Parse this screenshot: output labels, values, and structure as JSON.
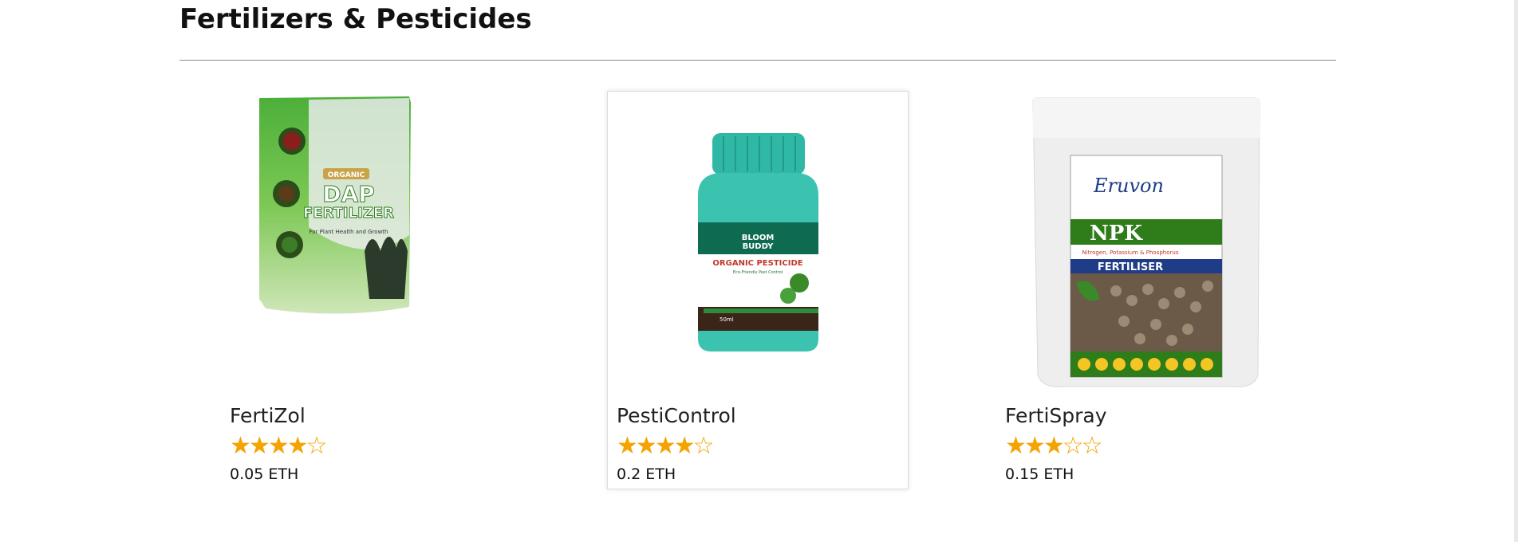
{
  "section": {
    "title": "Fertilizers & Pesticides"
  },
  "products": [
    {
      "name": "FertiZol",
      "rating": 4,
      "max_rating": 5,
      "price": "0.05 ETH",
      "image_text": {
        "top": "ORGANIC",
        "main1": "DAP",
        "main2": "FERTILIZER",
        "tagline": "For Plant Health and Growth"
      }
    },
    {
      "name": "PestiControl",
      "rating": 4,
      "max_rating": 5,
      "price": "0.2 ETH",
      "image_text": {
        "brand1": "BLOOM",
        "brand2": "BUDDY",
        "main": "ORGANIC PESTICIDE",
        "sub": "Eco-Friendly Pest Control",
        "volume": "50ml"
      }
    },
    {
      "name": "FertiSpray",
      "rating": 3,
      "max_rating": 5,
      "price": "0.15 ETH",
      "image_text": {
        "brand": "Eruvon",
        "main": "NPK",
        "sub": "Nitrogen, Potassium & Phosphorus",
        "band": "FERTILISER"
      }
    }
  ],
  "colors": {
    "star": "#f4a300",
    "divider": "#8a8a8a",
    "bottle": "#3cc3b0",
    "bottle_band": "#0e6b52",
    "npk_green": "#2e7d1a",
    "npk_blue": "#1f3c88"
  }
}
